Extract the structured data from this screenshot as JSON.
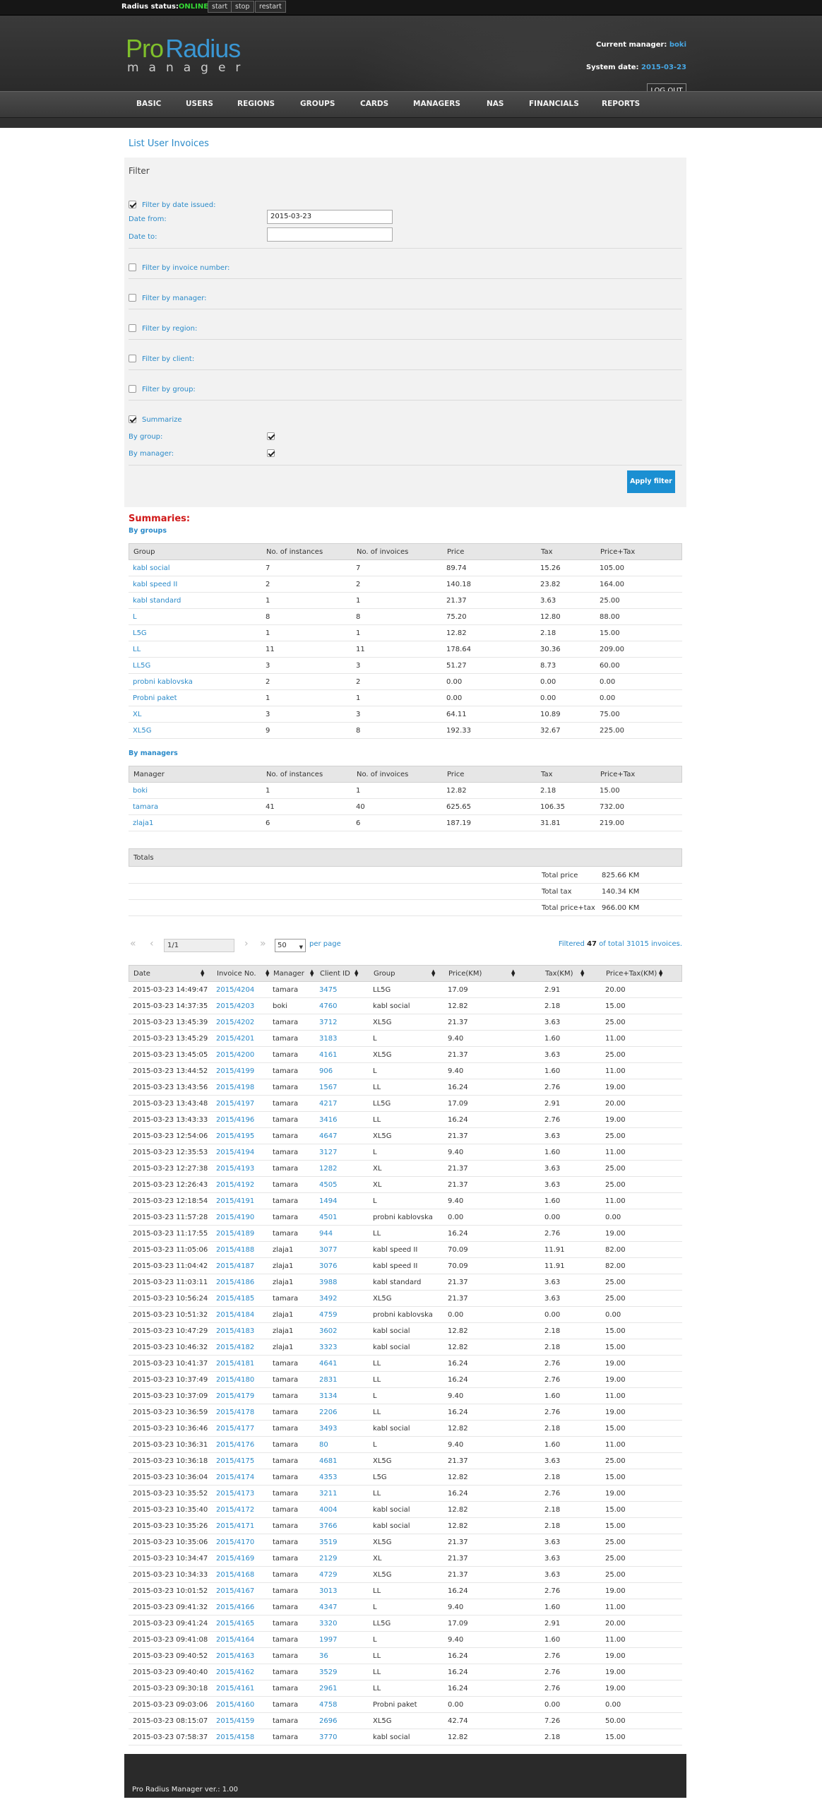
{
  "topbar": {
    "status_label": "Radius status:",
    "status_value": "ONLINE!",
    "buttons": [
      "start",
      "stop",
      "restart"
    ]
  },
  "header": {
    "logo_pro": "Pro",
    "logo_radius": "Radius",
    "logo_manager": "manager",
    "current_manager_label": "Current manager:",
    "current_manager": "boki",
    "system_date_label": "System date:",
    "system_date": "2015-03-23",
    "logout": "LOG OUT"
  },
  "nav": [
    "BASIC",
    "USERS",
    "REGIONS",
    "GROUPS",
    "CARDS",
    "MANAGERS",
    "NAS",
    "FINANCIALS",
    "REPORTS"
  ],
  "page_title": "List User Invoices",
  "filter": {
    "title": "Filter",
    "by_date": "Filter by date issued:",
    "date_from_label": "Date from:",
    "date_from": "2015-03-23",
    "date_to_label": "Date to:",
    "date_to": "",
    "by_invoice": "Filter by invoice number:",
    "by_manager": "Filter by manager:",
    "by_region": "Filter by region:",
    "by_client": "Filter by client:",
    "by_group": "Filter by group:",
    "summarize": "Summarize",
    "summ_by_group": "By group:",
    "summ_by_manager": "By manager:",
    "apply": "Apply filter"
  },
  "summaries": {
    "title": "Summaries:",
    "by_groups_label": "By groups",
    "by_managers_label": "By managers",
    "groups_headers": [
      "Group",
      "No. of instances",
      "No. of invoices",
      "Price",
      "Tax",
      "Price+Tax"
    ],
    "groups": [
      [
        "kabl social",
        "7",
        "7",
        "89.74",
        "15.26",
        "105.00"
      ],
      [
        "kabl speed II",
        "2",
        "2",
        "140.18",
        "23.82",
        "164.00"
      ],
      [
        "kabl standard",
        "1",
        "1",
        "21.37",
        "3.63",
        "25.00"
      ],
      [
        "L",
        "8",
        "8",
        "75.20",
        "12.80",
        "88.00"
      ],
      [
        "L5G",
        "1",
        "1",
        "12.82",
        "2.18",
        "15.00"
      ],
      [
        "LL",
        "11",
        "11",
        "178.64",
        "30.36",
        "209.00"
      ],
      [
        "LL5G",
        "3",
        "3",
        "51.27",
        "8.73",
        "60.00"
      ],
      [
        "probni kablovska",
        "2",
        "2",
        "0.00",
        "0.00",
        "0.00"
      ],
      [
        "Probni paket",
        "1",
        "1",
        "0.00",
        "0.00",
        "0.00"
      ],
      [
        "XL",
        "3",
        "3",
        "64.11",
        "10.89",
        "75.00"
      ],
      [
        "XL5G",
        "9",
        "8",
        "192.33",
        "32.67",
        "225.00"
      ]
    ],
    "managers_headers": [
      "Manager",
      "No. of instances",
      "No. of invoices",
      "Price",
      "Tax",
      "Price+Tax"
    ],
    "managers": [
      [
        "boki",
        "1",
        "1",
        "12.82",
        "2.18",
        "15.00"
      ],
      [
        "tamara",
        "41",
        "40",
        "625.65",
        "106.35",
        "732.00"
      ],
      [
        "zlaja1",
        "6",
        "6",
        "187.19",
        "31.81",
        "219.00"
      ]
    ],
    "totals_label": "Totals",
    "totals": [
      [
        "Total price",
        "825.66 KM"
      ],
      [
        "Total tax",
        "140.34 KM"
      ],
      [
        "Total price+tax",
        "966.00 KM"
      ]
    ]
  },
  "pager": {
    "first": "«",
    "prev": "‹",
    "page": "1/1",
    "next": "›",
    "last": "»",
    "per_page_value": "50",
    "per_page_label": "per page",
    "filtered_pre": "Filtered",
    "filtered_count": "47",
    "filtered_post": "of total 31015 invoices."
  },
  "invoices": {
    "headers": [
      "Date",
      "Invoice No.",
      "Manager",
      "Client ID",
      "Group",
      "Price(KM)",
      "Tax(KM)",
      "Price+Tax(KM)"
    ],
    "rows": [
      [
        "2015-03-23 14:49:47",
        "2015/4204",
        "tamara",
        "3475",
        "LL5G",
        "17.09",
        "2.91",
        "20.00"
      ],
      [
        "2015-03-23 14:37:35",
        "2015/4203",
        "boki",
        "4760",
        "kabl social",
        "12.82",
        "2.18",
        "15.00"
      ],
      [
        "2015-03-23 13:45:39",
        "2015/4202",
        "tamara",
        "3712",
        "XL5G",
        "21.37",
        "3.63",
        "25.00"
      ],
      [
        "2015-03-23 13:45:29",
        "2015/4201",
        "tamara",
        "3183",
        "L",
        "9.40",
        "1.60",
        "11.00"
      ],
      [
        "2015-03-23 13:45:05",
        "2015/4200",
        "tamara",
        "4161",
        "XL5G",
        "21.37",
        "3.63",
        "25.00"
      ],
      [
        "2015-03-23 13:44:52",
        "2015/4199",
        "tamara",
        "906",
        "L",
        "9.40",
        "1.60",
        "11.00"
      ],
      [
        "2015-03-23 13:43:56",
        "2015/4198",
        "tamara",
        "1567",
        "LL",
        "16.24",
        "2.76",
        "19.00"
      ],
      [
        "2015-03-23 13:43:48",
        "2015/4197",
        "tamara",
        "4217",
        "LL5G",
        "17.09",
        "2.91",
        "20.00"
      ],
      [
        "2015-03-23 13:43:33",
        "2015/4196",
        "tamara",
        "3416",
        "LL",
        "16.24",
        "2.76",
        "19.00"
      ],
      [
        "2015-03-23 12:54:06",
        "2015/4195",
        "tamara",
        "4647",
        "XL5G",
        "21.37",
        "3.63",
        "25.00"
      ],
      [
        "2015-03-23 12:35:53",
        "2015/4194",
        "tamara",
        "3127",
        "L",
        "9.40",
        "1.60",
        "11.00"
      ],
      [
        "2015-03-23 12:27:38",
        "2015/4193",
        "tamara",
        "1282",
        "XL",
        "21.37",
        "3.63",
        "25.00"
      ],
      [
        "2015-03-23 12:26:43",
        "2015/4192",
        "tamara",
        "4505",
        "XL",
        "21.37",
        "3.63",
        "25.00"
      ],
      [
        "2015-03-23 12:18:54",
        "2015/4191",
        "tamara",
        "1494",
        "L",
        "9.40",
        "1.60",
        "11.00"
      ],
      [
        "2015-03-23 11:57:28",
        "2015/4190",
        "tamara",
        "4501",
        "probni kablovska",
        "0.00",
        "0.00",
        "0.00"
      ],
      [
        "2015-03-23 11:17:55",
        "2015/4189",
        "tamara",
        "944",
        "LL",
        "16.24",
        "2.76",
        "19.00"
      ],
      [
        "2015-03-23 11:05:06",
        "2015/4188",
        "zlaja1",
        "3077",
        "kabl speed II",
        "70.09",
        "11.91",
        "82.00"
      ],
      [
        "2015-03-23 11:04:42",
        "2015/4187",
        "zlaja1",
        "3076",
        "kabl speed II",
        "70.09",
        "11.91",
        "82.00"
      ],
      [
        "2015-03-23 11:03:11",
        "2015/4186",
        "zlaja1",
        "3988",
        "kabl standard",
        "21.37",
        "3.63",
        "25.00"
      ],
      [
        "2015-03-23 10:56:24",
        "2015/4185",
        "tamara",
        "3492",
        "XL5G",
        "21.37",
        "3.63",
        "25.00"
      ],
      [
        "2015-03-23 10:51:32",
        "2015/4184",
        "zlaja1",
        "4759",
        "probni kablovska",
        "0.00",
        "0.00",
        "0.00"
      ],
      [
        "2015-03-23 10:47:29",
        "2015/4183",
        "zlaja1",
        "3602",
        "kabl social",
        "12.82",
        "2.18",
        "15.00"
      ],
      [
        "2015-03-23 10:46:32",
        "2015/4182",
        "zlaja1",
        "3323",
        "kabl social",
        "12.82",
        "2.18",
        "15.00"
      ],
      [
        "2015-03-23 10:41:37",
        "2015/4181",
        "tamara",
        "4641",
        "LL",
        "16.24",
        "2.76",
        "19.00"
      ],
      [
        "2015-03-23 10:37:49",
        "2015/4180",
        "tamara",
        "2831",
        "LL",
        "16.24",
        "2.76",
        "19.00"
      ],
      [
        "2015-03-23 10:37:09",
        "2015/4179",
        "tamara",
        "3134",
        "L",
        "9.40",
        "1.60",
        "11.00"
      ],
      [
        "2015-03-23 10:36:59",
        "2015/4178",
        "tamara",
        "2206",
        "LL",
        "16.24",
        "2.76",
        "19.00"
      ],
      [
        "2015-03-23 10:36:46",
        "2015/4177",
        "tamara",
        "3493",
        "kabl social",
        "12.82",
        "2.18",
        "15.00"
      ],
      [
        "2015-03-23 10:36:31",
        "2015/4176",
        "tamara",
        "80",
        "L",
        "9.40",
        "1.60",
        "11.00"
      ],
      [
        "2015-03-23 10:36:18",
        "2015/4175",
        "tamara",
        "4681",
        "XL5G",
        "21.37",
        "3.63",
        "25.00"
      ],
      [
        "2015-03-23 10:36:04",
        "2015/4174",
        "tamara",
        "4353",
        "L5G",
        "12.82",
        "2.18",
        "15.00"
      ],
      [
        "2015-03-23 10:35:52",
        "2015/4173",
        "tamara",
        "3211",
        "LL",
        "16.24",
        "2.76",
        "19.00"
      ],
      [
        "2015-03-23 10:35:40",
        "2015/4172",
        "tamara",
        "4004",
        "kabl social",
        "12.82",
        "2.18",
        "15.00"
      ],
      [
        "2015-03-23 10:35:26",
        "2015/4171",
        "tamara",
        "3766",
        "kabl social",
        "12.82",
        "2.18",
        "15.00"
      ],
      [
        "2015-03-23 10:35:06",
        "2015/4170",
        "tamara",
        "3519",
        "XL5G",
        "21.37",
        "3.63",
        "25.00"
      ],
      [
        "2015-03-23 10:34:47",
        "2015/4169",
        "tamara",
        "2129",
        "XL",
        "21.37",
        "3.63",
        "25.00"
      ],
      [
        "2015-03-23 10:34:33",
        "2015/4168",
        "tamara",
        "4729",
        "XL5G",
        "21.37",
        "3.63",
        "25.00"
      ],
      [
        "2015-03-23 10:01:52",
        "2015/4167",
        "tamara",
        "3013",
        "LL",
        "16.24",
        "2.76",
        "19.00"
      ],
      [
        "2015-03-23 09:41:32",
        "2015/4166",
        "tamara",
        "4347",
        "L",
        "9.40",
        "1.60",
        "11.00"
      ],
      [
        "2015-03-23 09:41:24",
        "2015/4165",
        "tamara",
        "3320",
        "LL5G",
        "17.09",
        "2.91",
        "20.00"
      ],
      [
        "2015-03-23 09:41:08",
        "2015/4164",
        "tamara",
        "1997",
        "L",
        "9.40",
        "1.60",
        "11.00"
      ],
      [
        "2015-03-23 09:40:52",
        "2015/4163",
        "tamara",
        "36",
        "LL",
        "16.24",
        "2.76",
        "19.00"
      ],
      [
        "2015-03-23 09:40:40",
        "2015/4162",
        "tamara",
        "3529",
        "LL",
        "16.24",
        "2.76",
        "19.00"
      ],
      [
        "2015-03-23 09:30:18",
        "2015/4161",
        "tamara",
        "2961",
        "LL",
        "16.24",
        "2.76",
        "19.00"
      ],
      [
        "2015-03-23 09:03:06",
        "2015/4160",
        "tamara",
        "4758",
        "Probni paket",
        "0.00",
        "0.00",
        "0.00"
      ],
      [
        "2015-03-23 08:15:07",
        "2015/4159",
        "tamara",
        "2696",
        "XL5G",
        "42.74",
        "7.26",
        "50.00"
      ],
      [
        "2015-03-23 07:58:37",
        "2015/4158",
        "tamara",
        "3770",
        "kabl social",
        "12.82",
        "2.18",
        "15.00"
      ]
    ]
  },
  "footer": "Pro Radius Manager  ver.: 1.00"
}
